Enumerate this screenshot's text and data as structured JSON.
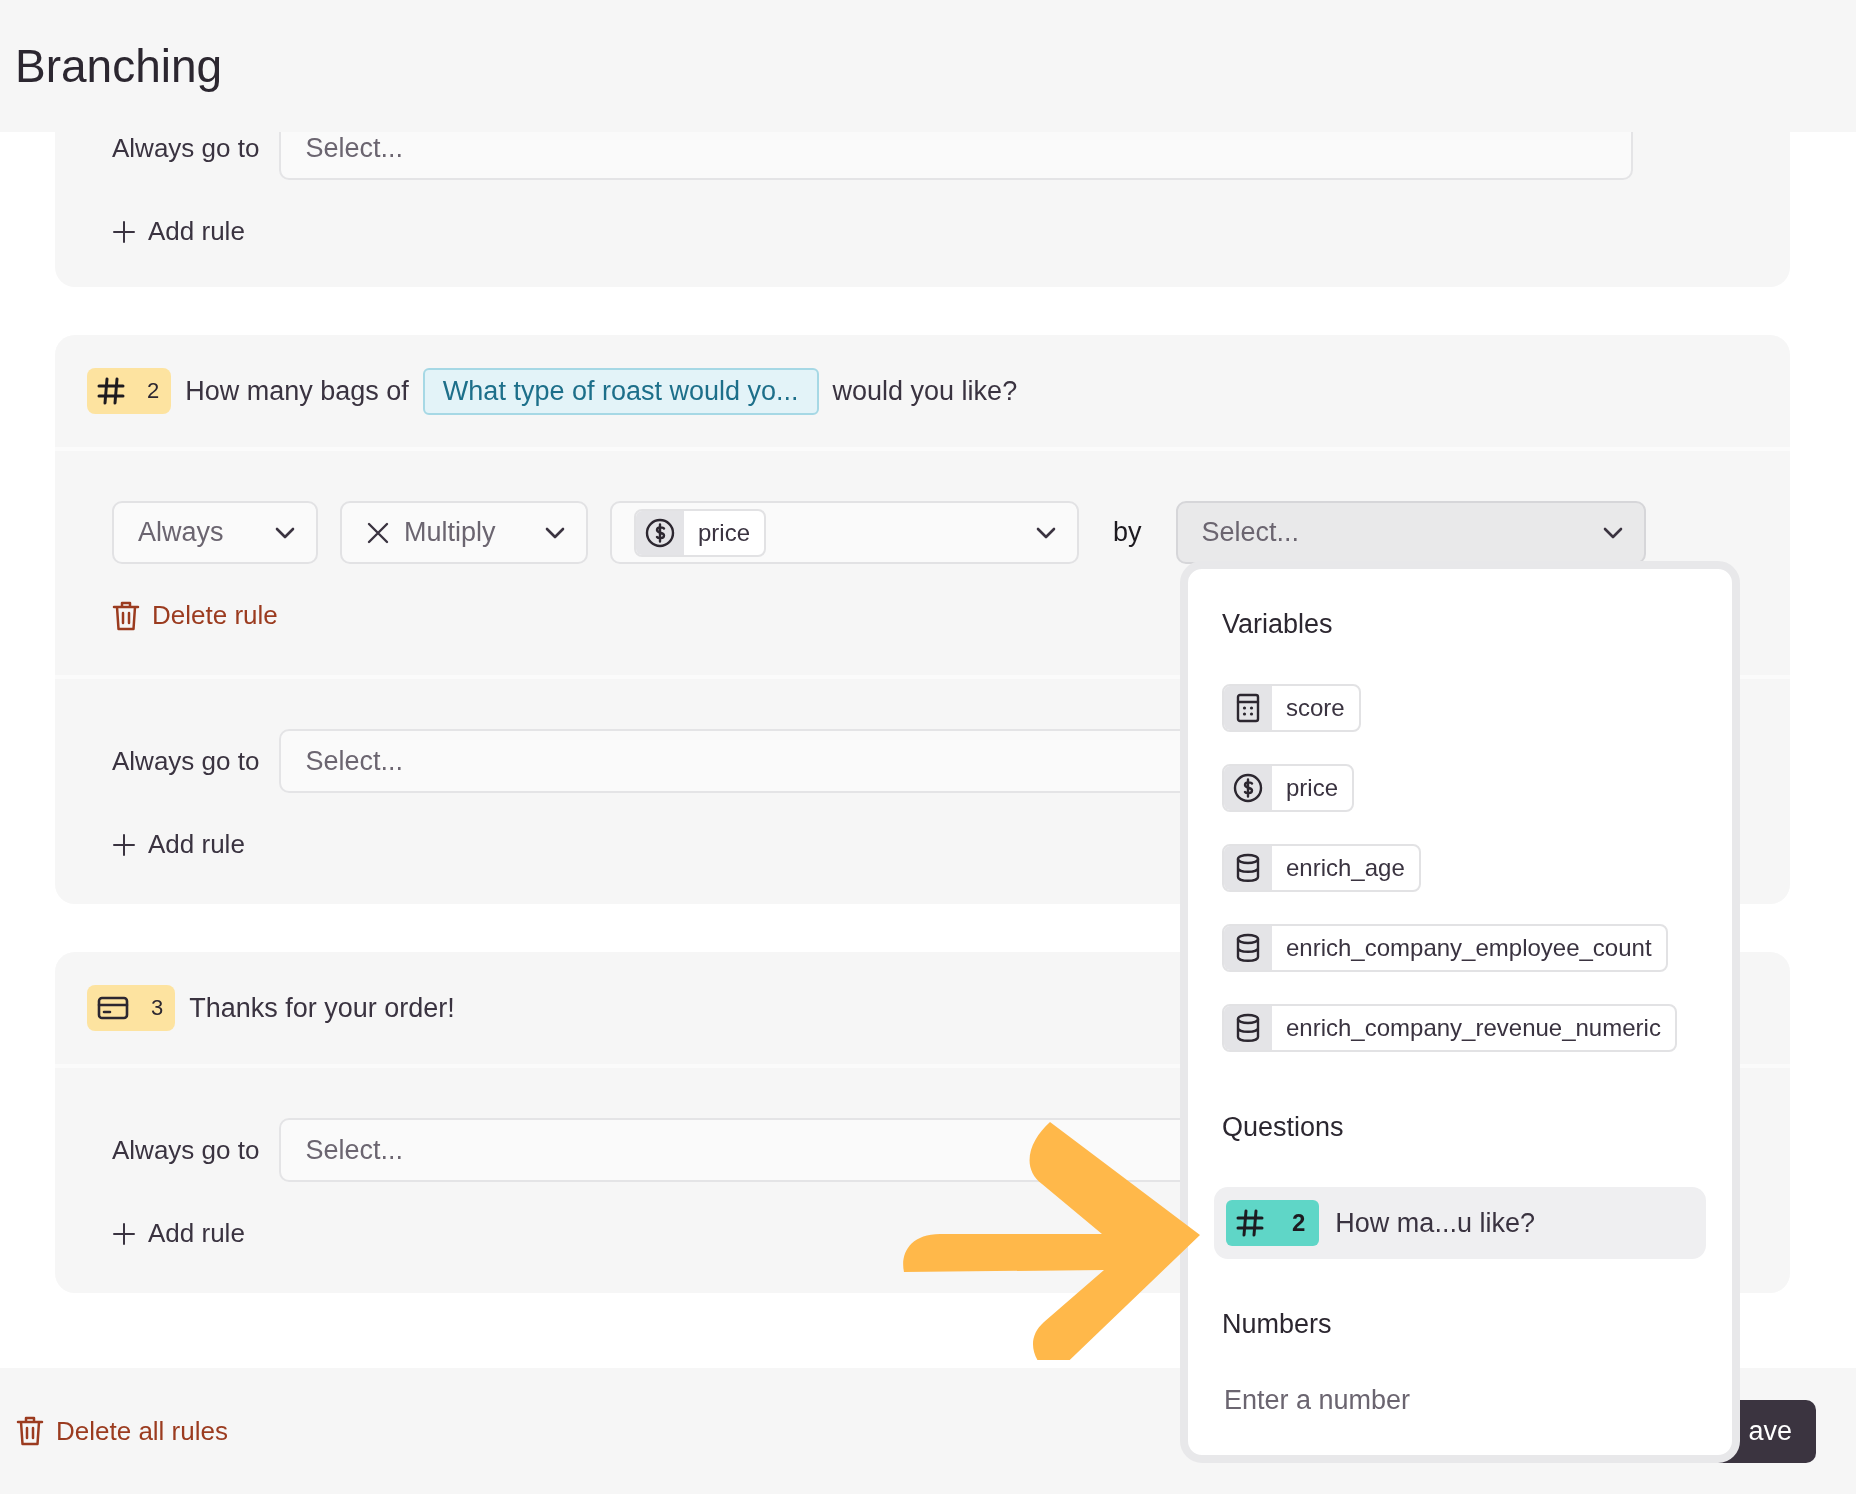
{
  "header": {
    "title": "Branching"
  },
  "cards": [
    {
      "goto": {
        "label": "Always go to",
        "placeholder": "Select..."
      },
      "add_rule": "Add rule"
    },
    {
      "question": {
        "kind": "number",
        "number": "2",
        "parts": [
          {
            "kind": "text",
            "text": "How many bags of"
          },
          {
            "kind": "reference",
            "text": "What type of roast would yo..."
          },
          {
            "kind": "text",
            "text": "would you like?"
          }
        ]
      },
      "rules": [
        {
          "condition": "Always",
          "operation": "Multiply",
          "variable": {
            "kind": "money",
            "name": "price"
          },
          "by": "by",
          "target": {
            "placeholder": "Select...",
            "open": true
          },
          "delete": "Delete rule"
        }
      ],
      "goto": {
        "label": "Always go to",
        "placeholder": "Select..."
      },
      "add_rule": "Add rule"
    },
    {
      "question": {
        "kind": "payment",
        "number": "3",
        "parts": [
          {
            "kind": "text",
            "text": "Thanks for your order!"
          }
        ]
      },
      "goto": {
        "label": "Always go to",
        "placeholder": "Select..."
      },
      "add_rule": "Add rule"
    }
  ],
  "footer": {
    "delete_all": "Delete all rules",
    "save": "ave"
  },
  "dropdown": {
    "sections": [
      {
        "kind": "variables",
        "heading": "Variables",
        "items": [
          {
            "kind": "calculator",
            "name": "score"
          },
          {
            "kind": "money",
            "name": "price"
          },
          {
            "kind": "database",
            "name": "enrich_age"
          },
          {
            "kind": "database",
            "name": "enrich_company_employee_count"
          },
          {
            "kind": "database",
            "name": "enrich_company_revenue_numeric"
          }
        ]
      },
      {
        "kind": "questions",
        "heading": "Questions",
        "items": [
          {
            "kind": "number",
            "number": "2",
            "name": "How ma...u like?",
            "selected": true
          }
        ]
      },
      {
        "kind": "numbers",
        "heading": "Numbers",
        "placeholder": "Enter a number"
      }
    ]
  }
}
